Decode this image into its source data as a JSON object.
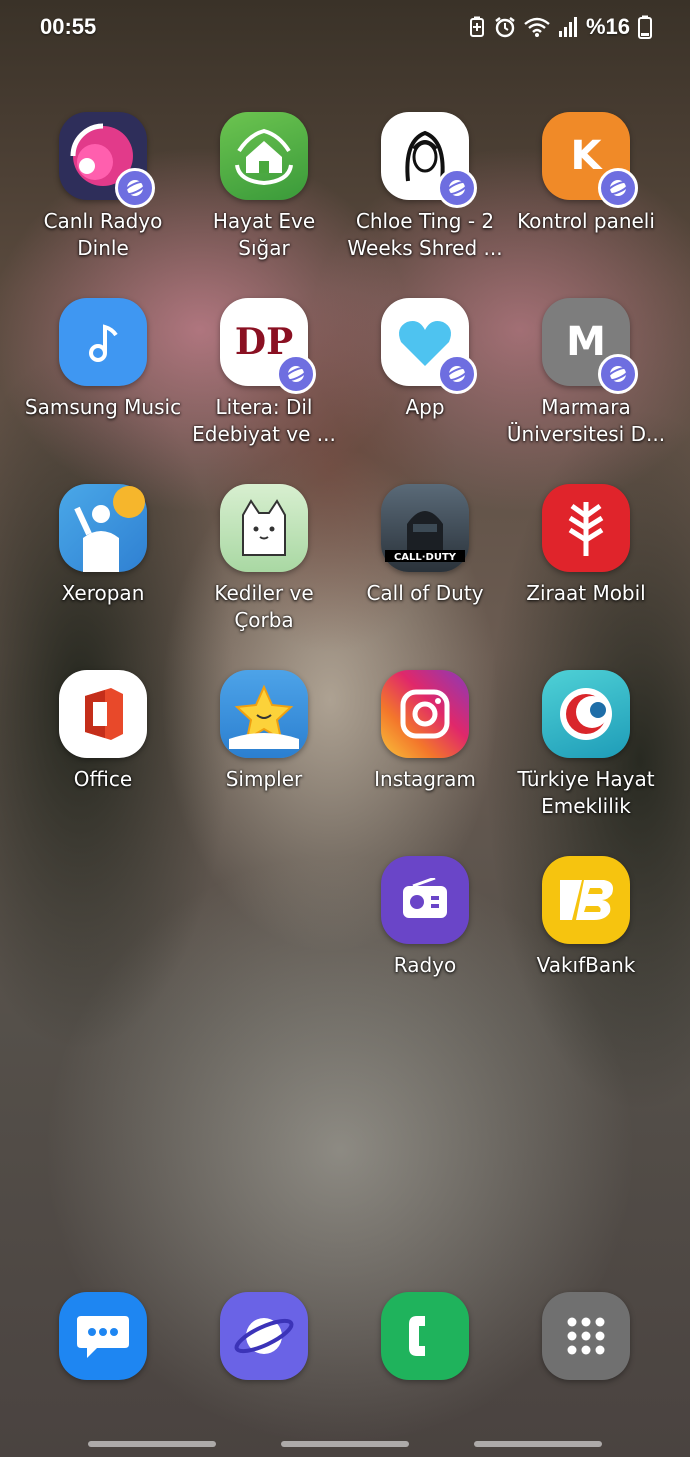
{
  "status_bar": {
    "time": "00:55",
    "battery": "%16"
  },
  "apps": [
    {
      "label": "Canlı Radyo\nDinle",
      "icon": "radio-waves-icon"
    },
    {
      "label": "Hayat Eve\nSığar",
      "icon": "home-hands-icon"
    },
    {
      "label": "Chloe Ting - 2\nWeeks Shred ...",
      "icon": "chloe-ting-icon"
    },
    {
      "label": "Kontrol paneli",
      "icon": "k-letter-icon"
    },
    {
      "label": "Samsung Music",
      "icon": "music-note-icon"
    },
    {
      "label": "Litera: Dil\nEdebiyat ve ...",
      "icon": "dp-akademi-icon"
    },
    {
      "label": "App",
      "icon": "heart-icon"
    },
    {
      "label": "Marmara\nÜniversitesi D...",
      "icon": "m-letter-icon"
    },
    {
      "label": "Xeropan",
      "icon": "xeropan-icon"
    },
    {
      "label": "Kediler ve\nÇorba",
      "icon": "cat-icon"
    },
    {
      "label": "Call of Duty",
      "icon": "call-of-duty-icon"
    },
    {
      "label": "Ziraat Mobil",
      "icon": "ziraat-wheat-icon"
    },
    {
      "label": "Office",
      "icon": "office-icon"
    },
    {
      "label": "Simpler",
      "icon": "star-icon"
    },
    {
      "label": "Instagram",
      "icon": "instagram-icon"
    },
    {
      "label": "Türkiye Hayat\nEmeklilik",
      "icon": "turkiye-hayat-icon"
    },
    {
      "label": "Radyo",
      "icon": "radio-icon"
    },
    {
      "label": "VakıfBank",
      "icon": "vakifbank-icon"
    }
  ],
  "dock": [
    {
      "name": "Messages",
      "icon": "messages-icon"
    },
    {
      "name": "Internet",
      "icon": "internet-icon"
    },
    {
      "name": "Phone",
      "icon": "phone-icon"
    },
    {
      "name": "Apps",
      "icon": "app-drawer-icon"
    }
  ],
  "colors": {
    "badge": "#6e6ee0",
    "samsung_music": "#3f97f2",
    "kontrol": "#f08a28",
    "ziraat": "#e0242b",
    "vakifbank": "#f6c40f",
    "radyo": "#6a45c8",
    "phone": "#1fb35c",
    "messages": "#1e86f2",
    "internet": "#6a63e6",
    "apps_drawer": "#707070"
  }
}
